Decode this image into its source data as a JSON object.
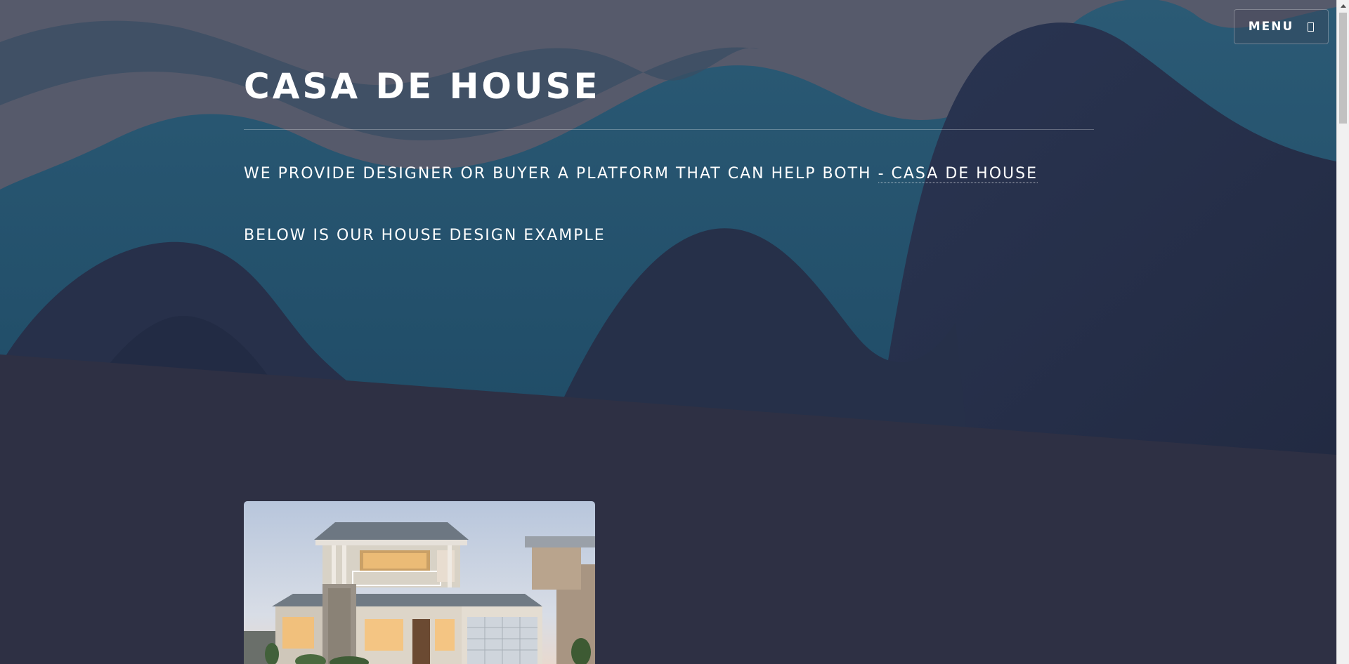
{
  "header": {
    "title": "CASA DE HOUSE",
    "tagline_prefix": "WE PROVIDE DESIGNER OR BUYER A PLATFORM THAT CAN HELP BOTH",
    "tagline_link": "- CASA DE HOUSE",
    "subline": "BELOW IS OUR HOUSE DESIGN EXAMPLE"
  },
  "menu": {
    "label": "MENU",
    "icon": "menu-icon"
  },
  "colors": {
    "background": "#2e3044",
    "wave_light": "#595b6c",
    "wave_teal": "#265470",
    "wave_dark": "#272c44"
  },
  "gallery": {
    "items": [
      {
        "icon": "house-photo"
      }
    ]
  }
}
